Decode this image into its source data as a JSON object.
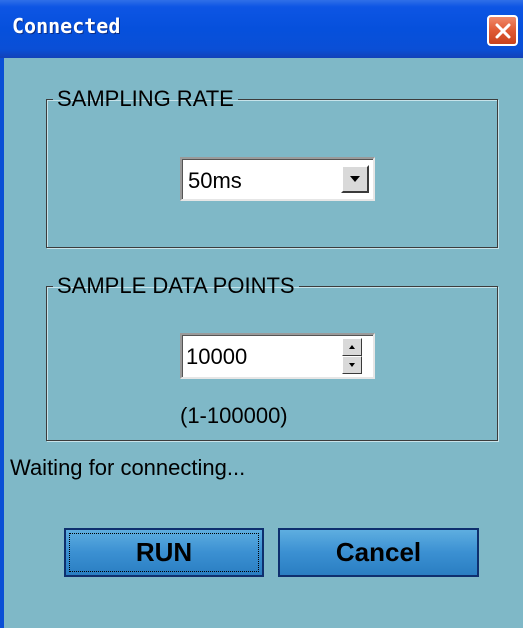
{
  "window": {
    "title": "Connected"
  },
  "sampling_rate": {
    "legend": "SAMPLING RATE",
    "selected": "50ms"
  },
  "sample_points": {
    "legend": "SAMPLE DATA POINTS",
    "value": "10000",
    "range_hint": "(1-100000)"
  },
  "status": "Waiting for connecting...",
  "buttons": {
    "run_label": "RUN",
    "cancel_label": "Cancel"
  },
  "colors": {
    "dialog_bg": "#7fb8c7",
    "titlebar": "#0650dc",
    "close_button": "#e05a34",
    "button_face": "#3b90d2"
  }
}
